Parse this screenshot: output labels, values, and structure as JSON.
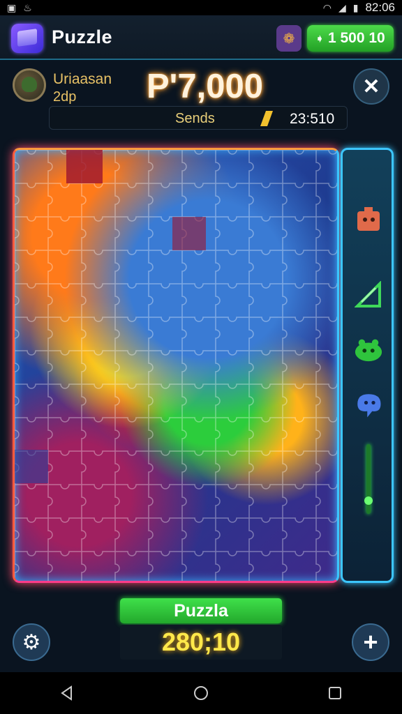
{
  "status_bar": {
    "time": "82:06",
    "icons": [
      "image-icon",
      "android-debug-icon",
      "wifi-icon",
      "cellular-signal-icon",
      "battery-icon"
    ]
  },
  "app_bar": {
    "title": "Puzzle",
    "currency": "1 500 10",
    "icons": [
      "puzzle-cube-logo-icon",
      "shop-bag-icon",
      "coin-icon"
    ]
  },
  "player": {
    "name": "Uriaasan",
    "subtitle": "2dp",
    "score": "P'7,000",
    "progress_label": "Sends",
    "progress_value": "23:510"
  },
  "side_tools": {
    "icons": [
      "monster-face-icon",
      "pencil-ruler-icon",
      "green-creature-icon",
      "blue-creature-icon",
      "zoom-slider-icon"
    ],
    "zoom_level": 0.15
  },
  "bottom": {
    "action_label": "Puzzla",
    "level_value": "280;10"
  },
  "navbar": {
    "icons": [
      "back-triangle-icon",
      "home-circle-icon",
      "recents-square-icon"
    ]
  },
  "colors": {
    "accent_green": "#3fe04a",
    "score_glow": "#ff9a2a",
    "level_yellow": "#ffe84a",
    "frame_cyan": "#3cc6ff",
    "frame_red": "#ff5a3c"
  }
}
